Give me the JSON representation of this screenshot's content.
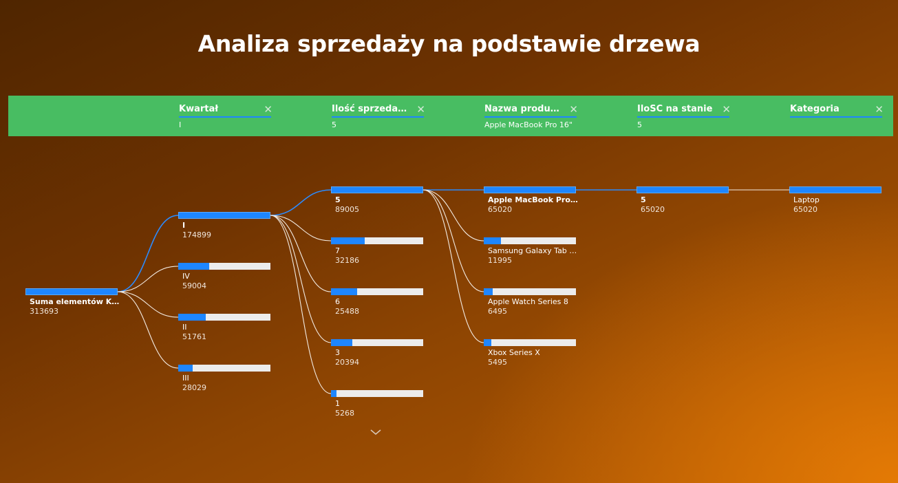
{
  "page": {
    "title": "Analiza sprzedaży na podstawie drzewa"
  },
  "header": {
    "columns": [
      {
        "label": "Kwartał",
        "value": "I"
      },
      {
        "label": "Ilość sprzedanyc...",
        "value": "5"
      },
      {
        "label": "Nazwa produktu",
        "value": "Apple MacBook Pro 16\""
      },
      {
        "label": "IloŚĆ na stanie",
        "value": "5"
      },
      {
        "label": "Kategoria",
        "value": ""
      }
    ],
    "close_icon": "close-icon"
  },
  "tree": {
    "root": {
      "label": "Suma elementów Kw...",
      "value": "313693",
      "fraction": 1.0
    },
    "levels": [
      [
        {
          "label": "I",
          "value": "174899",
          "fraction": 1.0,
          "selected": true
        },
        {
          "label": "IV",
          "value": "59004",
          "fraction": 0.337
        },
        {
          "label": "II",
          "value": "51761",
          "fraction": 0.296
        },
        {
          "label": "III",
          "value": "28029",
          "fraction": 0.16
        }
      ],
      [
        {
          "label": "5",
          "value": "89005",
          "fraction": 1.0,
          "selected": true
        },
        {
          "label": "7",
          "value": "32186",
          "fraction": 0.362
        },
        {
          "label": "6",
          "value": "25488",
          "fraction": 0.286
        },
        {
          "label": "3",
          "value": "20394",
          "fraction": 0.229
        },
        {
          "label": "1",
          "value": "5268",
          "fraction": 0.059
        }
      ],
      [
        {
          "label": "Apple MacBook Pro ...",
          "value": "65020",
          "fraction": 1.0,
          "selected": true
        },
        {
          "label": "Samsung Galaxy Tab S...",
          "value": "11995",
          "fraction": 0.184
        },
        {
          "label": "Apple Watch Series 8",
          "value": "6495",
          "fraction": 0.1
        },
        {
          "label": "Xbox Series X",
          "value": "5495",
          "fraction": 0.085
        }
      ],
      [
        {
          "label": "5",
          "value": "65020",
          "fraction": 1.0,
          "selected": true
        }
      ],
      [
        {
          "label": "Laptop",
          "value": "65020",
          "fraction": 1.0,
          "selected": false
        }
      ]
    ]
  },
  "controls": {
    "expand_icon": "chevron-down-icon"
  },
  "colors": {
    "accent": "#1e86ff",
    "header_bg": "#48bd62",
    "bar_bg": "#ececec"
  }
}
